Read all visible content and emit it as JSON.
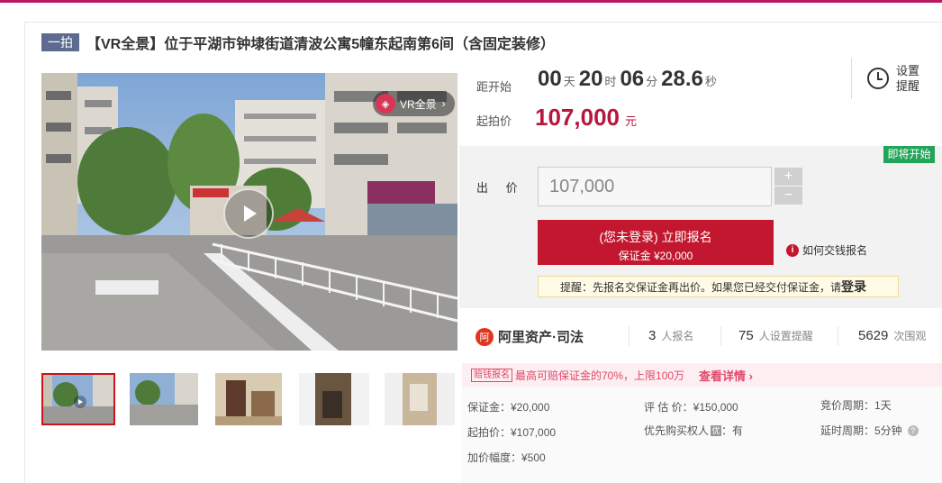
{
  "listing": {
    "badge": "一拍",
    "title": "【VR全景】位于平湖市钟埭街道清波公寓5幢东起南第6间（含固定装修）"
  },
  "gallery": {
    "vr_label": "VR全景",
    "vr_logo": "◈",
    "vr_arrow": "›",
    "thumbnails": [
      "street-view-1",
      "street-view-2",
      "interior-door",
      "interior-bathroom",
      "interior-wall"
    ]
  },
  "countdown": {
    "label": "距开始",
    "days": "00",
    "days_unit": "天",
    "hours": "20",
    "hours_unit": "时",
    "minutes": "06",
    "minutes_unit": "分",
    "seconds": "28.6",
    "seconds_unit": "秒"
  },
  "start_price": {
    "label": "起拍价",
    "value": "107,000",
    "unit": "元"
  },
  "reminder": {
    "label": "设置提醒"
  },
  "status_badge": "即将开始",
  "bid": {
    "label": "出 价",
    "value": "107,000",
    "plus": "+",
    "minus": "−"
  },
  "register_button": {
    "line1": "(您未登录) 立即报名",
    "line2": "保证金 ¥20,000"
  },
  "howto": {
    "icon": "i",
    "text": "如何交钱报名"
  },
  "tip": {
    "text": "提醒：先报名交保证金再出价。如果您已经交付保证金，请",
    "link": "登录"
  },
  "platform": {
    "logo_mark": "阿",
    "name": "阿里资产·司法"
  },
  "stats": [
    {
      "num": "3",
      "label": "人报名"
    },
    {
      "num": "75",
      "label": "人设置提醒"
    },
    {
      "num": "5629",
      "label": "次围观"
    }
  ],
  "insurance": {
    "tag": "赔钱报名",
    "text": "最高可赔保证金的70%，上限100万",
    "link": "查看详情 ›"
  },
  "specs": {
    "deposit": "保证金：¥20,000",
    "appraisal": "评 估 价：¥150,000",
    "cycle": "竞价周期：1天",
    "start": "起拍价：¥107,000",
    "priority_label": "优先购买权人",
    "priority_icon": "优",
    "priority_value": "：有",
    "delay": "延时周期：5分钟",
    "increment": "加价幅度：¥500"
  },
  "colors": {
    "accent": "#c2172e",
    "brand_line": "#b8185f",
    "status_green": "#22a55a",
    "badge_blue": "#5c6b8f"
  }
}
